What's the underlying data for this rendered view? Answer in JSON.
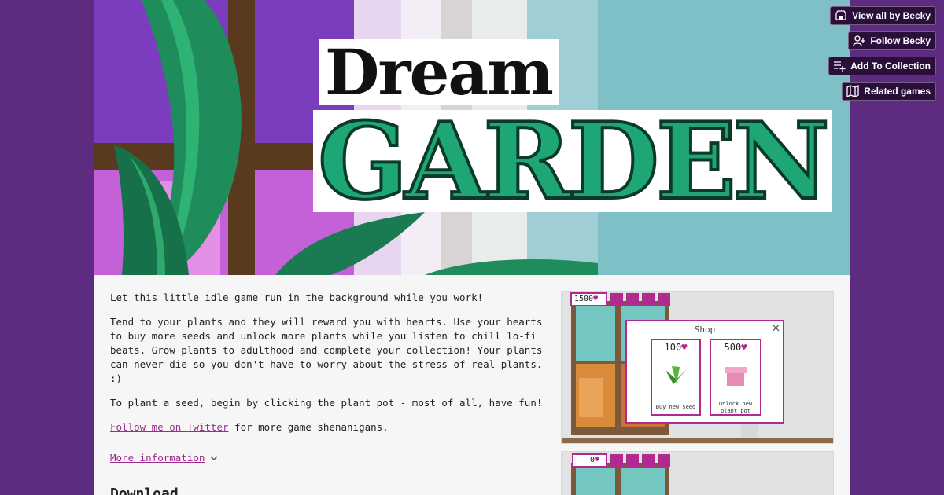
{
  "actions": {
    "view_all": "View all by Becky",
    "follow": "Follow Becky",
    "add_collection": "Add To Collection",
    "related": "Related games"
  },
  "title": {
    "line1": "Dream",
    "line2": "GARDEN"
  },
  "description": {
    "p1": "Let this little idle game run in the background while you work!",
    "p2": "Tend to your plants and they will reward you with hearts. Use your hearts to buy more seeds and unlock more plants while you listen to chill lo-fi beats. Grow plants to adulthood and complete your collection! Your plants can never die so you don't have to worry about the stress of real plants. :)",
    "p3": "To plant a seed, begin by clicking the plant pot - most of all, have fun!",
    "twitter_link": "Follow me on Twitter",
    "twitter_rest": " for more game shenanigans."
  },
  "more_info": "More information",
  "download_heading": "Download",
  "screenshot1": {
    "hearts": "1500",
    "shop_title": "Shop",
    "close": "×",
    "item1_price": "100",
    "item1_label": "Buy new seed",
    "item2_price": "500",
    "item2_label_1": "Unlock new",
    "item2_label_2": "plant pot"
  },
  "screenshot2": {
    "hearts": "0"
  },
  "colors": {
    "background": "#5d2b80",
    "page": "#f6f6f6",
    "link": "#a0288f",
    "button_bg": "#2a0f3b",
    "ui_magenta": "#b02a8f",
    "leaf_green": "#1f8c5c"
  }
}
